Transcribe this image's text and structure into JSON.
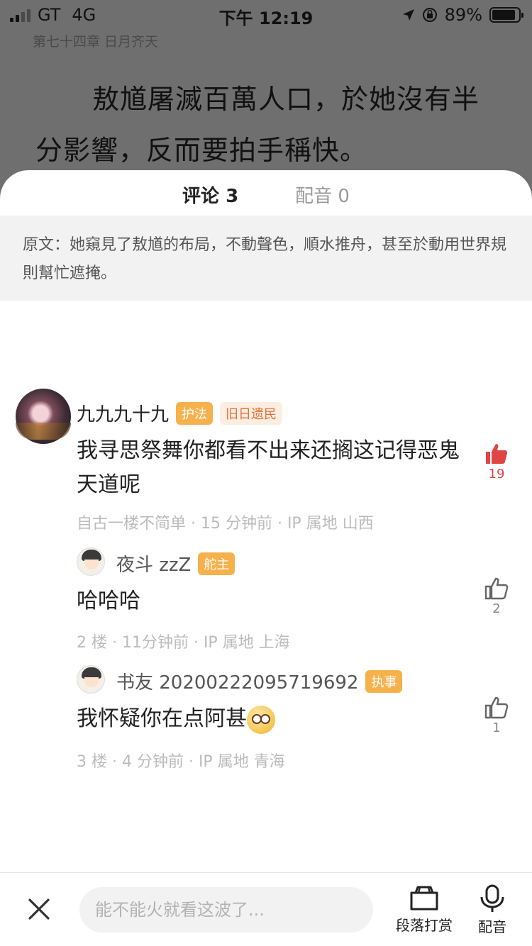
{
  "status_bar": {
    "carrier": "GT",
    "network": "4G",
    "time": "下午 12:19",
    "battery": "89%",
    "battery_level": 0.89
  },
  "reader": {
    "chapter_title": "第七十四章 日月齐天",
    "body": "敖馗屠滅百萬人口，於她沒有半分影響，反而要拍手稱快。"
  },
  "sheet": {
    "tabs": [
      {
        "label": "评论 3",
        "active": true
      },
      {
        "label": "配音 0",
        "active": false
      }
    ],
    "original_quote": "原文：她窺見了敖馗的布局，不動聲色，順水推舟，甚至於動用世界規則幫忙遮掩。"
  },
  "comments": [
    {
      "username": "九九九十九",
      "badges": [
        "护法",
        "旧日遗民"
      ],
      "text": "我寻思祭舞你都看不出来还搁这记得恶鬼天道呢",
      "meta": "自古一楼不简单 · 15 分钟前 · IP 属地 山西",
      "likes": "19",
      "liked": true
    },
    {
      "username": "夜斗 zzZ",
      "badges": [
        "舵主"
      ],
      "text": "哈哈哈",
      "meta": "2 楼 · 11分钟前 · IP 属地 上海",
      "likes": "2",
      "liked": false
    },
    {
      "username": "书友 20200222095719692",
      "badges": [
        "执事"
      ],
      "text": "我怀疑你在点阿甚",
      "emoji": "dizzy-eyes-emoji",
      "meta": "3 楼 · 4 分钟前 · IP 属地 青海",
      "likes": "1",
      "liked": false
    }
  ],
  "bottom_bar": {
    "input_placeholder": "能不能火就看这波了...",
    "reward_label": "段落打赏",
    "dub_label": "配音"
  },
  "colors": {
    "accent_red": "#e04545",
    "badge_orange": "#f5b14b",
    "badge_pink_bg": "#fdeee2",
    "badge_pink_text": "#e2703a"
  }
}
